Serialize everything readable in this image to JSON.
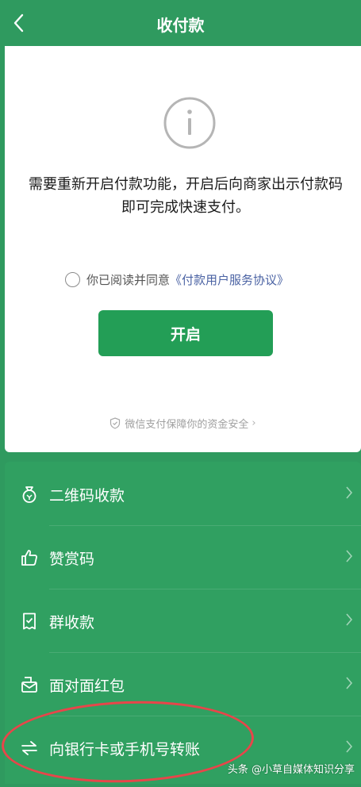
{
  "header": {
    "title": "收付款"
  },
  "card": {
    "message": "需要重新开启付款功能，开启后向商家出示付款码即可完成快速支付。",
    "agree_text": "你已阅读并同意",
    "agree_link": "《付款用户服务协议》",
    "open_button": "开启",
    "safety_text": "微信支付保障你的资金安全"
  },
  "menu": {
    "items": [
      {
        "label": "二维码收款",
        "icon": "money-bag-icon"
      },
      {
        "label": "赞赏码",
        "icon": "thumbs-up-icon"
      },
      {
        "label": "群收款",
        "icon": "receipt-icon"
      },
      {
        "label": "面对面红包",
        "icon": "red-packet-icon"
      },
      {
        "label": "向银行卡或手机号转账",
        "icon": "transfer-icon"
      }
    ]
  },
  "watermark": "头条 @小草自媒体知识分享",
  "colors": {
    "background": "#2f9a5f",
    "button": "#239e56",
    "link": "#4a62a3",
    "annotation": "#e8454a"
  }
}
